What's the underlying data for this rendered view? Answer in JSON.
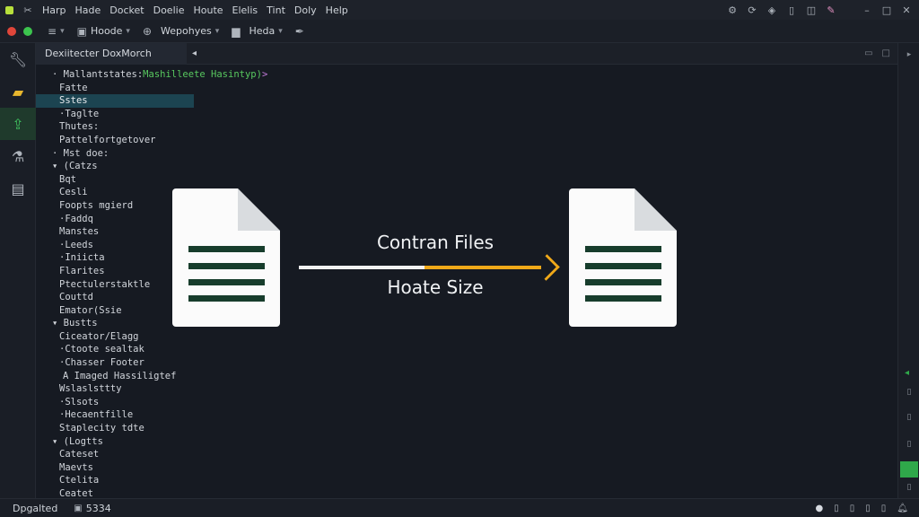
{
  "menubar": {
    "items": [
      "Harp",
      "Hade",
      "Docket",
      "Doelie",
      "Houte",
      "Elelis",
      "Tint",
      "Doly",
      "Help"
    ]
  },
  "toolbar": {
    "items": [
      {
        "label": "Hoode",
        "icon": "list-icon"
      },
      {
        "label": "Wepohyes",
        "icon": "globe-icon"
      },
      {
        "label": "Heda",
        "icon": "folder-icon"
      }
    ]
  },
  "tab": {
    "label": "Dexiitecter DoxMorch"
  },
  "tree": {
    "signature": {
      "name": "Mallantstates:",
      "value": "Mashilleete Hasintyp)",
      "bracket": ">"
    },
    "rows": [
      "Fatte",
      "Sstes",
      "·Taglte",
      "Thutes:",
      "Pattelfortgetover",
      "· Mst doe:",
      "▾ (Catzs",
      "Bqt",
      "Cesli",
      "Foopts mgierd",
      "·Faddq",
      "Manstes",
      "·Leeds",
      "·Iniicta",
      "Flarites",
      "Ptectulerstaktle",
      "Couttd",
      "Emator(Ssie",
      "▾ Bustts",
      "Ciceator/Elagg",
      "·Ctoote sealtak",
      "·Chasser Footer",
      "A Imaged Hassiligtef",
      "Wslaslsttty",
      "·Slsots",
      "·Hecaentfille",
      "Staplecity tdte",
      "▾ (Logtts",
      "Cateset",
      "Maevts",
      "Ctelita",
      "Ceatet"
    ],
    "selected_index": 1
  },
  "compare": {
    "title": "Contran Files",
    "subtitle": "Hoate Size",
    "arrow_color_start": "#f2f2f2",
    "arrow_color_end": "#f0a919"
  },
  "statusbar": {
    "left": "Dpgalted",
    "size": "5334"
  },
  "colors": {
    "accent_green": "#2fa84a",
    "folder_yellow": "#e8b72e",
    "doc_lines": "#173d2c"
  }
}
